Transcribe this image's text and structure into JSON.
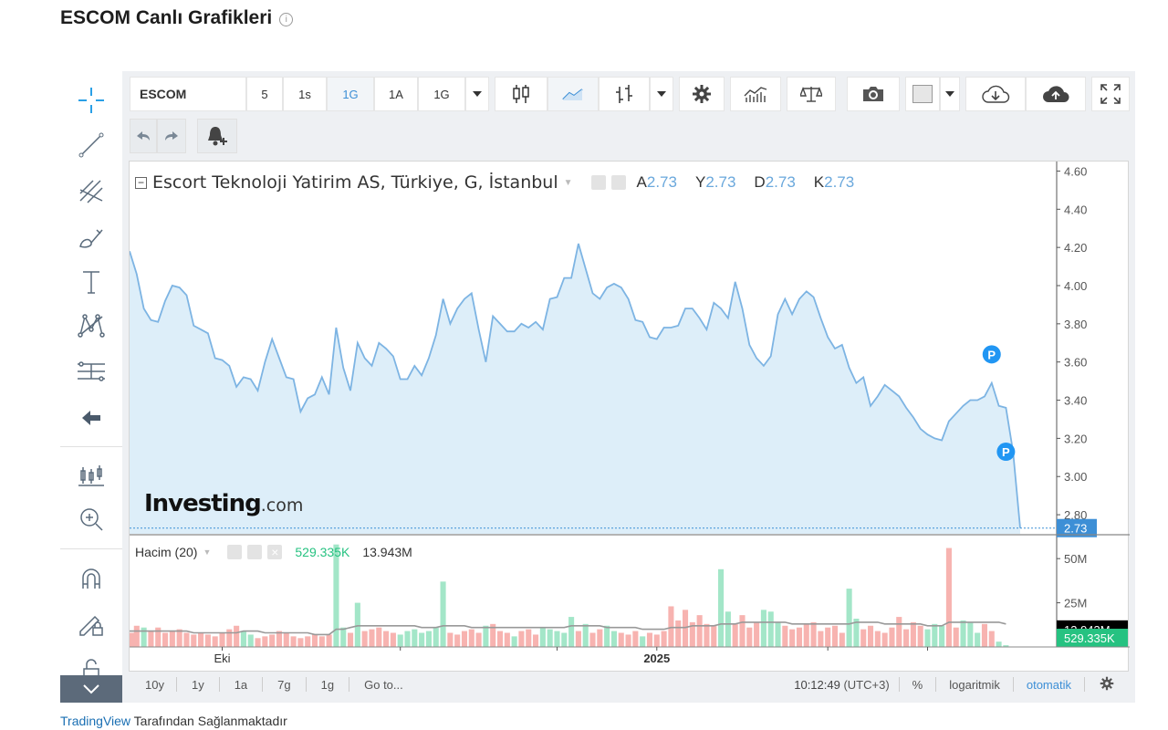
{
  "page": {
    "title": "ESCOM Canlı Grafikleri",
    "credit_link": "TradingView",
    "credit_text": " Tarafından Sağlanmaktadır"
  },
  "toolbar": {
    "symbol": "ESCOM",
    "intervals": [
      "5",
      "1s",
      "1G",
      "1A",
      "1G"
    ],
    "active_interval_index": 2
  },
  "legend": {
    "title": "Escort Teknoloji Yatirim AS, Türkiye, G, İstanbul",
    "ohlc": [
      {
        "key": "A",
        "value": "2.73"
      },
      {
        "key": "Y",
        "value": "2.73"
      },
      {
        "key": "D",
        "value": "2.73"
      },
      {
        "key": "K",
        "value": "2.73"
      }
    ],
    "watermark_bold": "Investing",
    "watermark_light": ".com"
  },
  "volume_legend": {
    "title": "Hacim (20)",
    "value1": "529.335K",
    "value2": "13.943M"
  },
  "bottom_bar": {
    "ranges": [
      "10y",
      "1y",
      "1a",
      "7g",
      "1g",
      "Go to..."
    ],
    "time": "10:12:49",
    "timezone": "(UTC+3)",
    "percent": "%",
    "log": "logaritmik",
    "auto": "otomatik"
  },
  "colors": {
    "line": "#7db4e3",
    "area": "#ddeef9",
    "up_volume": "#a3e6c8",
    "down_volume": "#f7b3b0",
    "ma": "#999999",
    "price_tag": "#3d8fd6",
    "volume_tag": "#26c281",
    "marker": "#2196f3"
  },
  "chart_data": [
    {
      "type": "line",
      "title": "Escort Teknoloji Yatirim AS, Türkiye, G, İstanbul",
      "ylim": [
        2.7,
        4.65
      ],
      "yticks": [
        "4.60",
        "4.40",
        "4.20",
        "4.00",
        "3.80",
        "3.60",
        "3.40",
        "3.20",
        "3.00",
        "2.80"
      ],
      "last_price": "2.73",
      "xticks": [
        {
          "label": "Eki",
          "bold": false,
          "index": 13
        },
        {
          "label": "2025",
          "bold": true,
          "index": 74
        }
      ],
      "values": [
        4.18,
        4.06,
        3.88,
        3.82,
        3.81,
        3.92,
        4.0,
        3.99,
        3.95,
        3.79,
        3.77,
        3.75,
        3.62,
        3.61,
        3.58,
        3.47,
        3.52,
        3.51,
        3.45,
        3.6,
        3.72,
        3.62,
        3.52,
        3.51,
        3.34,
        3.41,
        3.43,
        3.52,
        3.43,
        3.78,
        3.57,
        3.45,
        3.7,
        3.62,
        3.58,
        3.7,
        3.67,
        3.63,
        3.51,
        3.51,
        3.58,
        3.53,
        3.62,
        3.74,
        3.93,
        3.8,
        3.88,
        3.93,
        3.96,
        3.77,
        3.6,
        3.84,
        3.8,
        3.76,
        3.76,
        3.8,
        3.78,
        3.81,
        3.77,
        3.93,
        3.94,
        4.04,
        4.04,
        4.22,
        4.09,
        3.96,
        3.93,
        3.99,
        4.01,
        3.99,
        3.93,
        3.82,
        3.81,
        3.73,
        3.72,
        3.78,
        3.78,
        3.79,
        3.88,
        3.88,
        3.83,
        3.77,
        3.91,
        3.88,
        3.83,
        4.02,
        3.88,
        3.69,
        3.62,
        3.58,
        3.63,
        3.85,
        3.93,
        3.85,
        3.93,
        3.97,
        3.94,
        3.83,
        3.73,
        3.67,
        3.69,
        3.57,
        3.49,
        3.52,
        3.37,
        3.42,
        3.48,
        3.45,
        3.42,
        3.36,
        3.31,
        3.25,
        3.22,
        3.2,
        3.19,
        3.29,
        3.33,
        3.37,
        3.4,
        3.4,
        3.42,
        3.49,
        3.37,
        3.36,
        3.13,
        2.73
      ],
      "markers": [
        {
          "index": 121,
          "label": "P",
          "value": 3.64
        },
        {
          "index": 123,
          "label": "P",
          "value": 3.13
        }
      ]
    },
    {
      "type": "bar",
      "title": "Hacim (20)",
      "ylim": [
        0,
        63
      ],
      "yticks": [
        "50M",
        "25M"
      ],
      "unit": "M",
      "volumes": [
        8,
        12,
        11,
        9,
        11,
        8,
        9,
        10,
        8,
        7,
        8,
        7,
        6,
        8,
        10,
        12,
        9,
        7,
        5,
        6,
        7,
        9,
        8,
        6,
        5,
        6,
        7,
        6,
        7,
        58,
        11,
        8,
        25,
        9,
        10,
        11,
        9,
        8,
        7,
        9,
        10,
        8,
        9,
        11,
        37,
        8,
        7,
        9,
        10,
        8,
        12,
        13,
        9,
        8,
        6,
        9,
        10,
        7,
        11,
        10,
        9,
        8,
        17,
        9,
        13,
        8,
        10,
        12,
        9,
        8,
        7,
        9,
        6,
        8,
        7,
        9,
        23,
        15,
        21,
        14,
        18,
        13,
        12,
        44,
        20,
        13,
        18,
        11,
        14,
        21,
        20,
        14,
        12,
        10,
        11,
        13,
        14,
        9,
        11,
        12,
        8,
        33,
        16,
        10,
        12,
        9,
        8,
        11,
        17,
        10,
        14,
        12,
        10,
        13,
        12,
        56,
        11,
        15,
        14,
        8,
        13,
        9,
        3,
        1
      ],
      "up": [
        0,
        0,
        1,
        0,
        0,
        0,
        0,
        0,
        0,
        0,
        0,
        0,
        0,
        0,
        0,
        0,
        1,
        1,
        0,
        0,
        0,
        0,
        0,
        0,
        0,
        0,
        0,
        0,
        0,
        1,
        1,
        0,
        1,
        0,
        0,
        0,
        0,
        0,
        1,
        1,
        1,
        1,
        1,
        1,
        1,
        0,
        0,
        0,
        0,
        0,
        1,
        0,
        0,
        0,
        1,
        0,
        0,
        0,
        1,
        1,
        1,
        1,
        1,
        0,
        1,
        0,
        0,
        1,
        1,
        0,
        0,
        0,
        1,
        0,
        0,
        0,
        0,
        0,
        0,
        0,
        0,
        0,
        0,
        1,
        1,
        0,
        0,
        0,
        0,
        1,
        1,
        1,
        0,
        0,
        0,
        0,
        0,
        0,
        0,
        0,
        0,
        1,
        1,
        0,
        0,
        0,
        0,
        0,
        0,
        0,
        0,
        0,
        1,
        1,
        1,
        0,
        0,
        1,
        1,
        1,
        0,
        0,
        1,
        1
      ],
      "ma20": [
        9,
        9,
        9,
        9,
        9,
        9,
        9,
        9,
        9,
        8,
        8,
        8,
        8,
        8,
        8,
        8,
        9,
        9,
        9,
        8,
        8,
        8,
        8,
        8,
        8,
        8,
        7,
        7,
        7,
        10,
        10,
        11,
        12,
        12,
        12,
        12,
        12,
        12,
        12,
        12,
        12,
        11,
        11,
        11,
        12,
        12,
        12,
        12,
        11,
        11,
        11,
        11,
        11,
        11,
        11,
        11,
        11,
        11,
        11,
        11,
        11,
        11,
        12,
        12,
        12,
        12,
        12,
        11,
        11,
        11,
        11,
        11,
        10,
        10,
        10,
        10,
        11,
        11,
        11,
        12,
        12,
        12,
        12,
        13,
        13,
        13,
        14,
        14,
        14,
        14,
        14,
        14,
        14,
        13,
        13,
        13,
        13,
        13,
        13,
        13,
        13,
        13,
        14,
        14,
        14,
        14,
        13,
        13,
        13,
        13,
        13,
        13,
        12,
        12,
        12,
        14,
        14,
        14,
        14,
        14,
        14,
        14,
        14,
        13
      ]
    }
  ]
}
